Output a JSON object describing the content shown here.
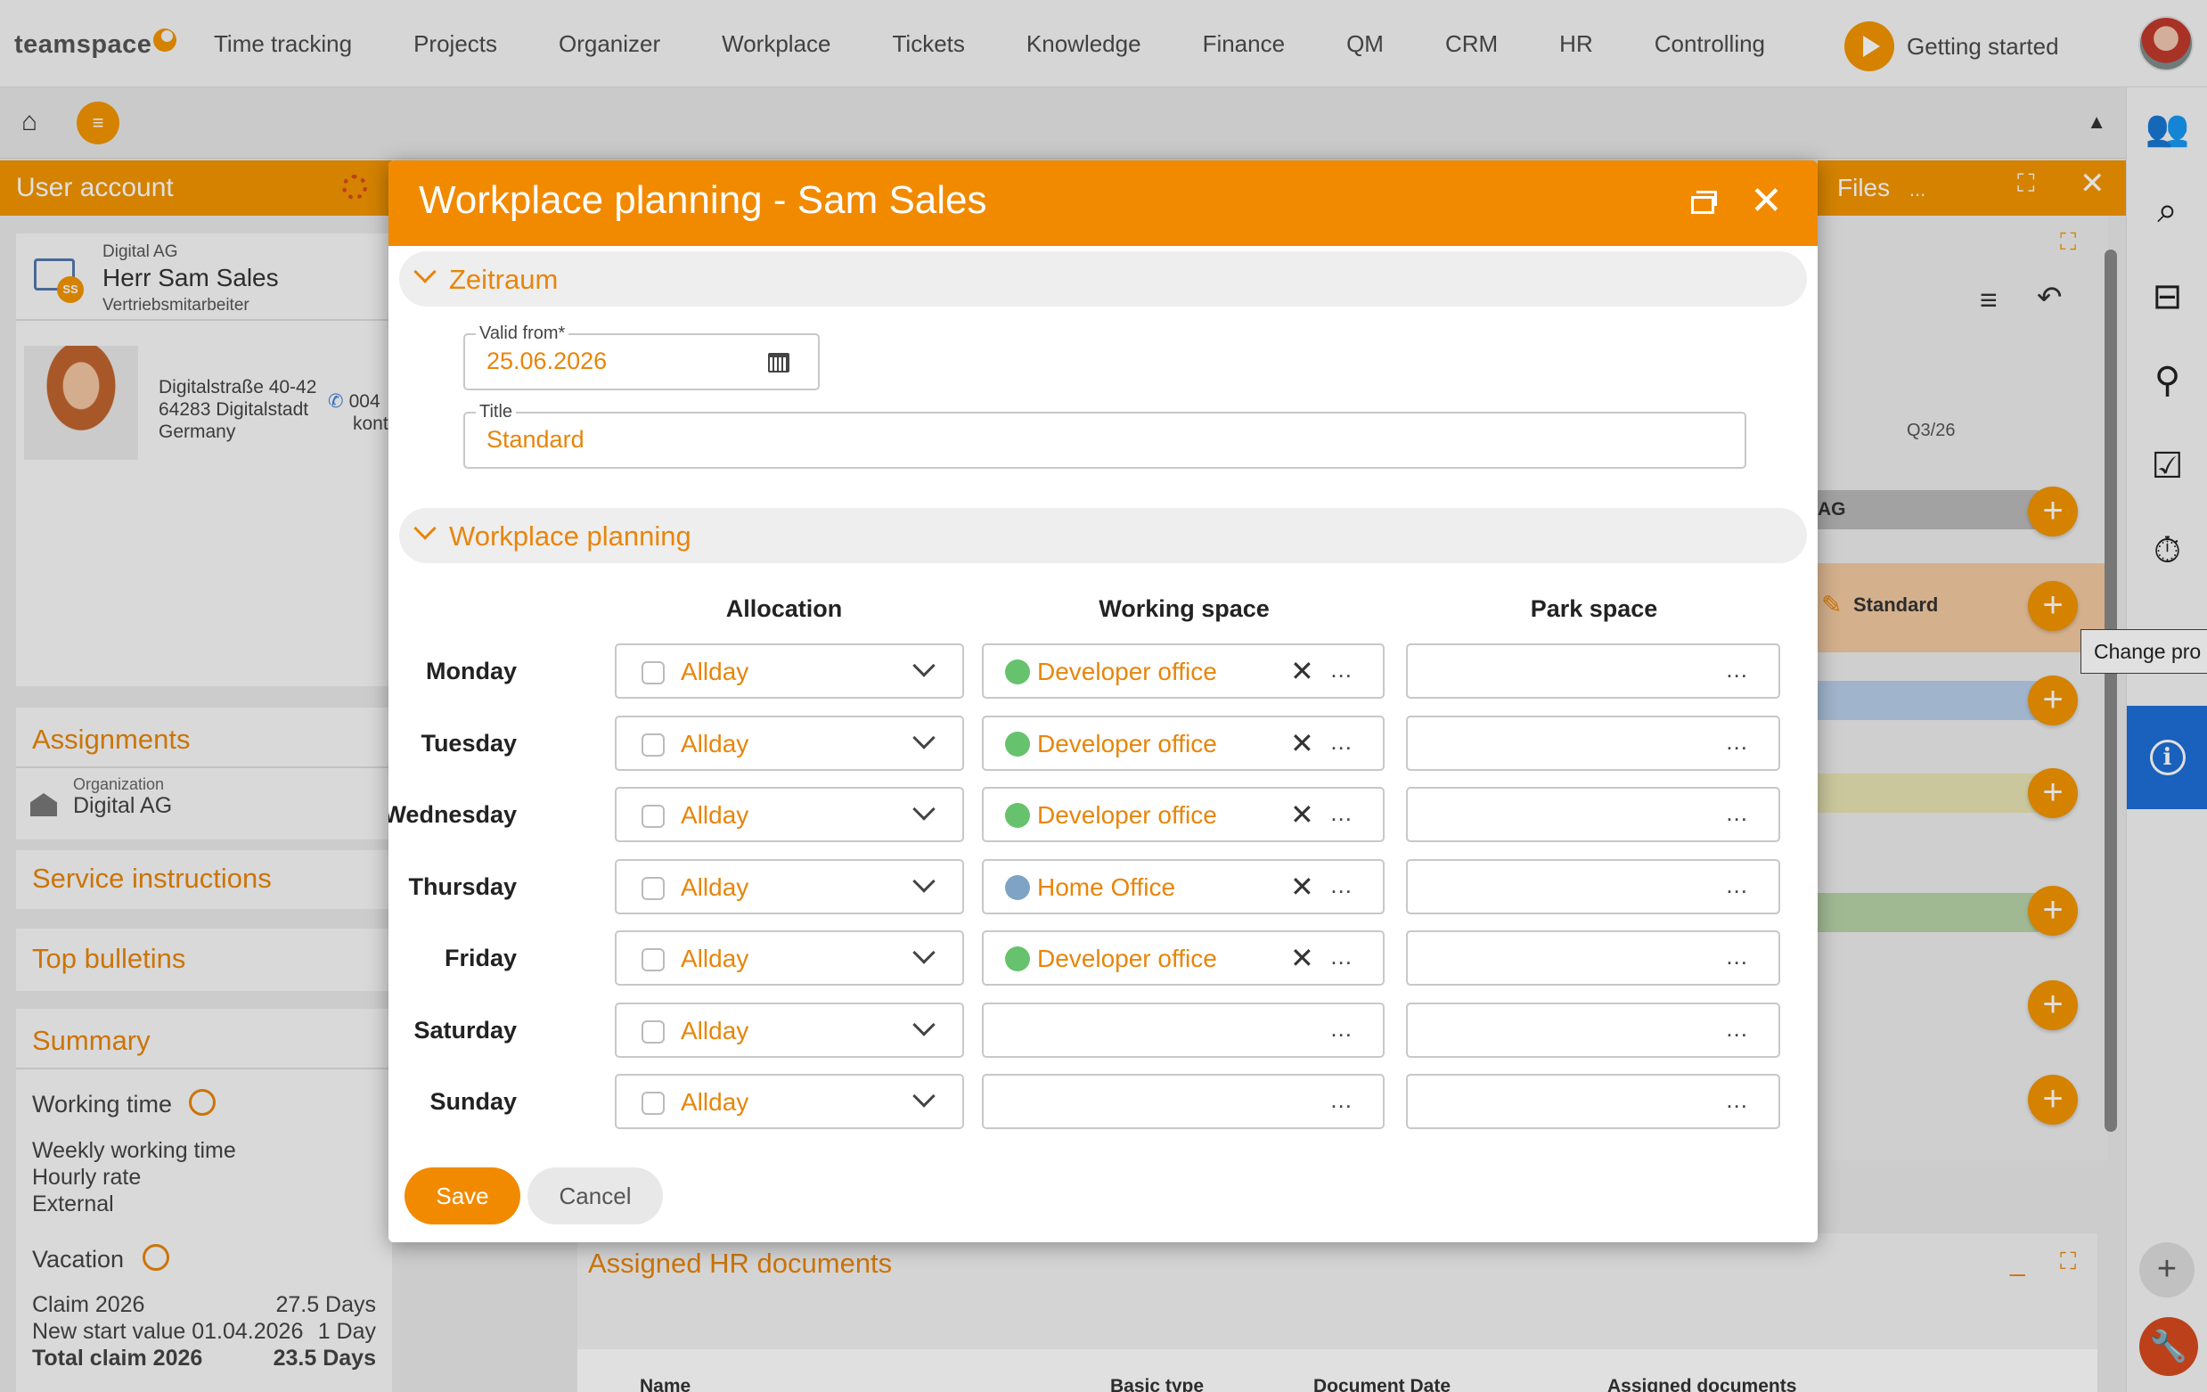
{
  "app": {
    "logo": "teamspace",
    "nav": [
      "Time tracking",
      "Projects",
      "Organizer",
      "Workplace",
      "Tickets",
      "Knowledge",
      "Finance",
      "QM",
      "CRM",
      "HR",
      "Controlling"
    ],
    "getting_started": "Getting started"
  },
  "left_panel": {
    "header": "User account",
    "company": "Digital AG",
    "name": "Herr Sam Sales",
    "role": "Vertriebsmitarbeiter",
    "badge": "SS",
    "address": [
      "Digitalstraße 40-42",
      "64283 Digitalstadt",
      "Germany"
    ],
    "phone": [
      "004",
      "kont"
    ],
    "assignments": {
      "title": "Assignments",
      "org_label": "Organization",
      "org_value": "Digital AG"
    },
    "service_instructions": "Service instructions",
    "top_bulletins": "Top bulletins",
    "summary": {
      "title": "Summary",
      "working_time": "Working time",
      "lines": [
        "Weekly working time",
        "Hourly rate",
        "External"
      ],
      "vacation": "Vacation",
      "claim_label": "Claim 2026",
      "claim_value": "27.5 Days",
      "start_label": "New start value 01.04.2026",
      "start_value": "1 Day",
      "total_label": "Total claim 2026",
      "total_value": "23.5 Days"
    }
  },
  "right_panel": {
    "header": "Files",
    "header_dots": "...",
    "quarter": "Q3/26",
    "band_label_1": "AG",
    "band_label_2": "Standard",
    "tooltip": "Change pro"
  },
  "hr_docs": {
    "title": "Assigned HR documents",
    "columns": [
      "Name",
      "Basic type",
      "Document Date",
      "Assigned documents"
    ]
  },
  "modal": {
    "title": "Workplace planning - Sam Sales",
    "section_period": "Zeitraum",
    "valid_from_label": "Valid from*",
    "valid_from_value": "25.06.2026",
    "title_label": "Title",
    "title_value": "Standard",
    "section_planning": "Workplace planning",
    "col_allocation": "Allocation",
    "col_working_space": "Working space",
    "col_park_space": "Park space",
    "rows": [
      {
        "day": "Monday",
        "allocation": "Allday",
        "working_space": "Developer office",
        "type": "office"
      },
      {
        "day": "Tuesday",
        "allocation": "Allday",
        "working_space": "Developer office",
        "type": "office"
      },
      {
        "day": "Wednesday",
        "allocation": "Allday",
        "working_space": "Developer office",
        "type": "office"
      },
      {
        "day": "Thursday",
        "allocation": "Allday",
        "working_space": "Home Office",
        "type": "home"
      },
      {
        "day": "Friday",
        "allocation": "Allday",
        "working_space": "Developer office",
        "type": "office"
      },
      {
        "day": "Saturday",
        "allocation": "Allday",
        "working_space": "",
        "type": "none"
      },
      {
        "day": "Sunday",
        "allocation": "Allday",
        "working_space": "",
        "type": "none"
      }
    ],
    "dots": "...",
    "save": "Save",
    "cancel": "Cancel"
  },
  "colors": {
    "accent": "#f28a00",
    "text_orange": "#e8850a",
    "info_blue": "#1d6fd6"
  }
}
